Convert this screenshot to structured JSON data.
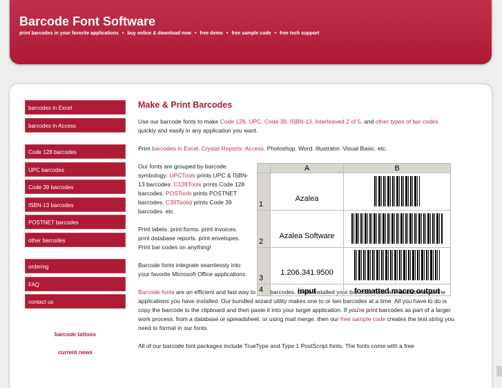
{
  "header": {
    "title": "Barcode Font Software",
    "tagline": [
      "print barcodes in your favorite applications",
      "buy online & download now",
      "free demo",
      "free sample code",
      "free tech support"
    ],
    "separator": "•"
  },
  "sidebar": {
    "group1": [
      "barcodes in Excel",
      "barcodes in Access"
    ],
    "group2": [
      "Code 128 barcodes",
      "UPC barcodes",
      "Code 39 barcodes",
      "ISBN-13 barcodes",
      "POSTNET barcodes",
      "other barcodes"
    ],
    "group3": [
      "ordering",
      "FAQ",
      "contact us"
    ],
    "links": [
      "barcode tattoos",
      "current news"
    ]
  },
  "main": {
    "title": "Make & Print Barcodes",
    "p1": {
      "t1": "Use our barcode fonts to make ",
      "l1": "Code 128",
      "l2": "UPC",
      "l3": "Code 39",
      "l4": "ISBN-13",
      "l5": "Interleaved 2 of 5",
      "t2": " and ",
      "l6": "other types of bar codes",
      "t3": " quickly and easily in any application you want."
    },
    "p2": {
      "t1": "Print ",
      "l1": "barcodes in Excel",
      "l2": "Crystal Reports",
      "l3": "Access",
      "t2": ". Photoshop. Word. Illustrator. Visual Basic. etc."
    },
    "p3": {
      "t1": "Our fonts are grouped by barcode symbology: ",
      "l1": "UPCTools",
      "t2": " prints UPC & ISBN-13 barcodes. ",
      "l2": "C128Tools",
      "t3": " prints Code 128 barcodes. ",
      "l3": "POSTools",
      "t4": " prints POSTNET barcodes. ",
      "l4": "C39Tools",
      "t5": ") prints Code 39 barcodes. etc."
    },
    "p4": "Print labels. print forms. print invoices. print database reports. print envelopes. Print bar codes on anything!",
    "p5": "Barcode fonts integrate seamlessly into your favorite Microsoft Office applications.",
    "p6": {
      "l1": "Barcode fonts",
      "t1": " are an efficient and fast way to print barcodes. Once installed your bar code fonts are available to all the applications you have installed. Our bundled wizard utility makes one to or two barcodes at a time. All you have to do is copy the barcode to the clipboard and then paste it into your target application. If you're print barcodes as part of a larger work process. from a database or spreadsheet. or using mail merge. then our ",
      "l2": "free sample code",
      "t2": " creates the text string you need to format in our fonts."
    },
    "p7": "All of our barcode font packages include TrueType and Type 1 PostScript fonts. The fonts come with a free"
  },
  "sheet": {
    "cols": [
      "A",
      "B"
    ],
    "rows": [
      {
        "n": "1",
        "a": "Azalea"
      },
      {
        "n": "2",
        "a": "Azalea Software"
      },
      {
        "n": "3",
        "a": "1.206.341.9500"
      }
    ],
    "footer": {
      "n": "4",
      "a": "input",
      "b": "formatted macro output"
    }
  }
}
